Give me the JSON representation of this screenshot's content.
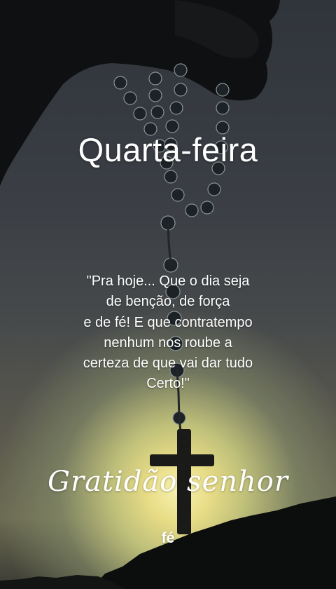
{
  "title": "Quarta-feira",
  "quote_lines": [
    "\"Pra hoje... Que o dia seja",
    "de benção, de força",
    "e de fé! E que contratempo",
    "nenhum nos roube a",
    "certeza de que vai dar tudo",
    "Certo!\""
  ],
  "signature": "Gratidão senhor",
  "brand": "fé",
  "colors": {
    "sky_top": "#30343b",
    "sun_glow": "#f7f2b0",
    "silhouette": "#0d0f10",
    "text": "#ffffff"
  }
}
